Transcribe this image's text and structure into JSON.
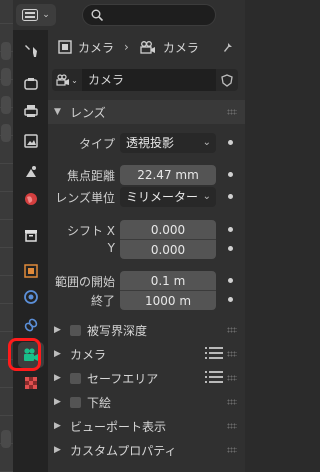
{
  "header": {
    "search_placeholder": ""
  },
  "panel": {
    "context_object": "カメラ",
    "context_data": "カメラ",
    "datablock_name": "カメラ"
  },
  "lens": {
    "section_label": "レンズ",
    "type_label": "タイプ",
    "type_value": "透視投影",
    "focal_label": "焦点距離",
    "focal_value": "22.47 mm",
    "unit_label": "レンズ単位",
    "unit_value": "ミリメーター",
    "shiftx_label": "シフト X",
    "shiftx_value": "0.000",
    "shifty_label": "Y",
    "shifty_value": "0.000",
    "clip_start_label": "範囲の開始",
    "clip_start_value": "0.1 m",
    "clip_end_label": "終了",
    "clip_end_value": "1000 m"
  },
  "sections": {
    "dof": "被写界深度",
    "camera": "カメラ",
    "safe_areas": "セーフエリア",
    "background": "下絵",
    "viewport_display": "ビューポート表示",
    "custom_props": "カスタムプロパティ"
  },
  "colors": {
    "highlight": "#ff1b1b",
    "camera_tab_icon": "#18c08a"
  }
}
